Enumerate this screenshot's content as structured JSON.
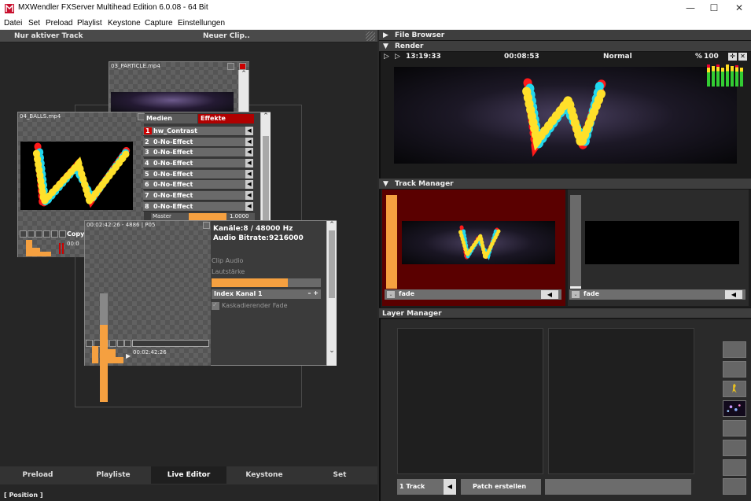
{
  "window": {
    "title": "MXWendler FXServer Multihead Edition 6.0.08  - 64 Bit",
    "controls": {
      "minimize": "—",
      "maximize": "☐",
      "close": "✕"
    }
  },
  "menu": [
    "Datei",
    "Set",
    "Preload",
    "Playlist",
    "Keystone",
    "Capture",
    "Einstellungen"
  ],
  "left_header": {
    "mode": "Nur aktiver Track",
    "new_clip": "Neuer Clip.."
  },
  "clips": {
    "particle": {
      "name": "03_PARTICLE.mp4"
    },
    "balls": {
      "name": "04_BALLS.mp4",
      "tabs": {
        "media": "Medien",
        "effects": "Effekte"
      },
      "effects": [
        {
          "n": "1",
          "label": "hw_Contrast"
        },
        {
          "n": "2",
          "label": "0-No-Effect"
        },
        {
          "n": "3",
          "label": "0-No-Effect"
        },
        {
          "n": "4",
          "label": "0-No-Effect"
        },
        {
          "n": "5",
          "label": "0-No-Effect"
        },
        {
          "n": "6",
          "label": "0-No-Effect"
        },
        {
          "n": "7",
          "label": "0-No-Effect"
        },
        {
          "n": "8",
          "label": "0-No-Effect"
        }
      ],
      "master_label": "Master",
      "master_value": "1.0000",
      "copy_key": "Copy zu Key In",
      "time_prefix": "00:0"
    },
    "audio": {
      "header": "00:02:42:26 - 4886 | P05",
      "channels": "Kanäle:8 / 48000 Hz",
      "bitrate": "Audio Bitrate:9216000",
      "clip_audio": "Clip Audio",
      "volume_label": "Lautstärke",
      "volume_level": 0.7,
      "index_channel": "Index Kanal 1",
      "cascading_fade": "Kaskadierender Fade",
      "time": "00:02:42:26"
    }
  },
  "tabs": [
    "Preload",
    "Playliste",
    "Live Editor",
    "Keystone",
    "Set"
  ],
  "active_tab": "Live Editor",
  "status": "[ Position ]",
  "right": {
    "file_browser": "File Browser",
    "render": {
      "title": "Render",
      "clock": "13:19:33",
      "elapsed": "00:08:53",
      "mode": "Normal",
      "percent_label": "%",
      "percent": "100"
    },
    "track_manager": {
      "title": "Track Manager",
      "tracks": [
        {
          "fade": "fade",
          "level": 1.0
        },
        {
          "fade": "fade",
          "level": 0.1
        }
      ]
    },
    "layer_manager": {
      "title": "Layer Manager",
      "track_count": "1 Track",
      "patch": "Patch erstellen"
    }
  },
  "colors": {
    "accent_orange": "#f5a040",
    "selected_track": "#5a0000",
    "effects_tab": "#b00000"
  }
}
